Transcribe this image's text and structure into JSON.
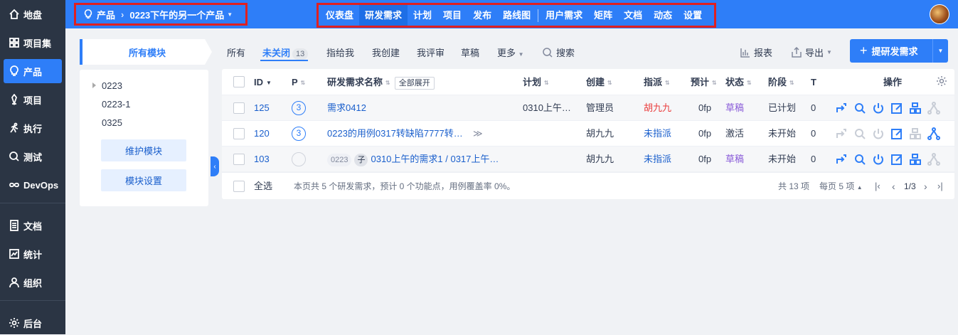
{
  "sidebar": {
    "items": [
      {
        "label": "地盘",
        "icon": "home-icon"
      },
      {
        "label": "项目集",
        "icon": "grid-icon"
      },
      {
        "label": "产品",
        "icon": "lightbulb-icon"
      },
      {
        "label": "项目",
        "icon": "project-icon"
      },
      {
        "label": "执行",
        "icon": "run-icon"
      },
      {
        "label": "测试",
        "icon": "test-icon"
      },
      {
        "label": "DevOps",
        "icon": "infinity-icon"
      },
      {
        "label": "文档",
        "icon": "document-icon"
      },
      {
        "label": "统计",
        "icon": "chart-icon"
      },
      {
        "label": "组织",
        "icon": "user-icon"
      },
      {
        "label": "后台",
        "icon": "gear-icon"
      }
    ]
  },
  "header": {
    "breadcrumb_root": "产品",
    "breadcrumb_product": "0223下午的另一个产品",
    "nav": [
      "仪表盘",
      "研发需求",
      "计划",
      "项目",
      "发布",
      "路线图",
      "用户需求",
      "矩阵",
      "文档",
      "动态",
      "设置"
    ]
  },
  "modules": {
    "tab_label": "所有模块",
    "tree": [
      "0223",
      "0223-1",
      "0325"
    ],
    "maintain_btn": "维护模块",
    "settings_btn": "模块设置"
  },
  "filters": {
    "tabs": [
      "所有",
      "未关闭",
      "指给我",
      "我创建",
      "我评审",
      "草稿"
    ],
    "unclosed_count": "13",
    "more": "更多",
    "search": "搜索",
    "report": "报表",
    "export": "导出",
    "create": "提研发需求"
  },
  "table": {
    "headers": {
      "id": "ID",
      "p": "P",
      "name": "研发需求名称",
      "expand": "全部展开",
      "plan": "计划",
      "creator": "创建",
      "assign": "指派",
      "estimate": "预计",
      "status": "状态",
      "stage": "阶段",
      "t": "T",
      "actions": "操作"
    },
    "rows": [
      {
        "id": "125",
        "pri": "3",
        "name": "需求0412",
        "plan": "0310上午…",
        "creator": "管理员",
        "assign": "胡九九",
        "estimate": "0fp",
        "status": "草稿",
        "stage": "已计划",
        "t": "0"
      },
      {
        "id": "120",
        "pri": "3",
        "name": "0223的用例0317转缺陷7777转…",
        "plan": "",
        "creator": "胡九九",
        "assign": "未指派",
        "estimate": "0fp",
        "status": "激活",
        "stage": "未开始",
        "t": "0"
      },
      {
        "id": "103",
        "pri": "",
        "module_tag": "0223",
        "sub_tag": "子",
        "name": "0310上午的需求1 / 0317上午…",
        "plan": "",
        "creator": "胡九九",
        "assign": "未指派",
        "estimate": "0fp",
        "status": "草稿",
        "stage": "未开始",
        "t": "0"
      }
    ],
    "footer": {
      "select_all": "全选",
      "summary": "本页共 5 个研发需求，预计 0 个功能点，用例覆盖率 0%。",
      "total": "共 13 项",
      "per_page": "每页 5 项",
      "page": "1/3"
    }
  }
}
